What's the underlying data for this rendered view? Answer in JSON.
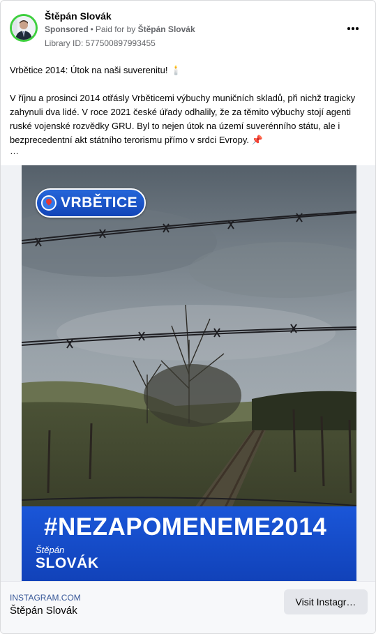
{
  "post": {
    "author": "Štěpán Slovák",
    "sponsored_label": "Sponsored",
    "paid_prefix": "Paid for by",
    "payer": "Štěpán Slovák",
    "library_id": "Library ID: 577500897993455",
    "body_p1": "Vrbětice 2014: Útok na naši suverenitu! 🕯️",
    "body_p2": "V říjnu a prosinci 2014 otřásly Vrběticemi výbuchy muničních skladů, při nichž tragicky zahynuli dva lidé. V roce 2021 české úřady odhalily, že za těmito výbuchy stojí agenti ruské vojenské rozvědky GRU. Byl to nejen útok na území suverénního státu, ale i bezprecedentní akt státního terorismu přímo v srdci Evropy. 📌",
    "ellipsis": "…"
  },
  "media": {
    "location_pill": "VRBĚTICE",
    "hashtag": "#NEZAPOMENEME2014",
    "logo_first": "Štěpán",
    "logo_last": "SLOVÁK"
  },
  "link": {
    "domain": "INSTAGRAM.COM",
    "title": "Štěpán Slovák",
    "cta": "Visit Instagr…"
  },
  "colors": {
    "avatar_ring": "#3ecf3e",
    "banner_blue": "#1a56d8",
    "link_blue": "#385898"
  },
  "icons": {
    "more": "more-horizontal-icon",
    "pin": "location-pin-icon"
  }
}
